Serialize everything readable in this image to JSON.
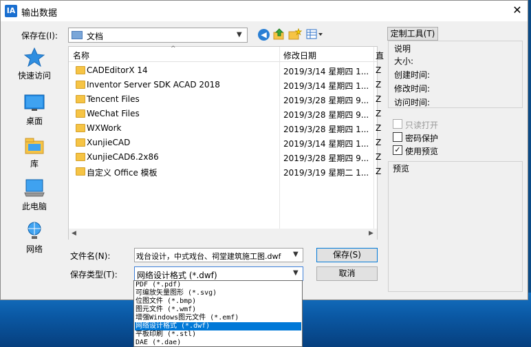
{
  "window": {
    "title": "输出数据",
    "icon_text": "IA",
    "close_glyph": "✕"
  },
  "lookin": {
    "label": "保存在(I):",
    "value": "文档"
  },
  "places": [
    {
      "label": "快速访问",
      "icon": "star-icon"
    },
    {
      "label": "桌面",
      "icon": "desktop-icon"
    },
    {
      "label": "库",
      "icon": "library-icon"
    },
    {
      "label": "此电脑",
      "icon": "computer-icon"
    },
    {
      "label": "网络",
      "icon": "network-icon"
    }
  ],
  "filelist": {
    "col_name": "名称",
    "col_date": "修改日期",
    "col_more": "直",
    "rows": [
      {
        "name": "CADEditorX 14",
        "date": "2019/3/14 星期四 1...",
        "extra": "Z"
      },
      {
        "name": "Inventor Server SDK ACAD 2018",
        "date": "2019/3/14 星期四 1...",
        "extra": "Z"
      },
      {
        "name": "Tencent Files",
        "date": "2019/3/28 星期四 9...",
        "extra": "Z"
      },
      {
        "name": "WeChat Files",
        "date": "2019/3/28 星期四 9...",
        "extra": "Z"
      },
      {
        "name": "WXWork",
        "date": "2019/3/28 星期四 1...",
        "extra": "Z"
      },
      {
        "name": "XunjieCAD",
        "date": "2019/3/14 星期四 1...",
        "extra": "Z"
      },
      {
        "name": "XunjieCAD6.2x86",
        "date": "2019/3/28 星期四 9...",
        "extra": "Z"
      },
      {
        "name": "自定义 Office 模板",
        "date": "2019/3/19 星期二 1...",
        "extra": "Z"
      }
    ]
  },
  "filename": {
    "label": "文件名(N):",
    "value": "戏台设计，中式戏台、祠堂建筑施工图.dwf"
  },
  "filetype": {
    "label": "保存类型(T):",
    "value": "网络设计格式 (*.dwf)",
    "options": [
      "PDF (*.pdf)",
      "可编放矢量图形 (*.svg)",
      "位图文件 (*.bmp)",
      "图元文件 (*.wmf)",
      "增强Windows图元文件 (*.emf)",
      "网络设计格式 (*.dwf)",
      "平板印刷 (*.stl)",
      "DAE (*.dae)"
    ],
    "selected_index": 5
  },
  "buttons": {
    "save": "保存(S)",
    "cancel": "取消",
    "custom": "定制工具(T)"
  },
  "details": {
    "title": "说明",
    "size": "大小:",
    "created": "创建时间:",
    "modified": "修改时间:",
    "accessed": "访问时间:"
  },
  "options": {
    "readonly": "只读打开",
    "password": "密码保护",
    "preview": "使用预览",
    "preview_checked": "✓"
  },
  "preview_label": "预览"
}
